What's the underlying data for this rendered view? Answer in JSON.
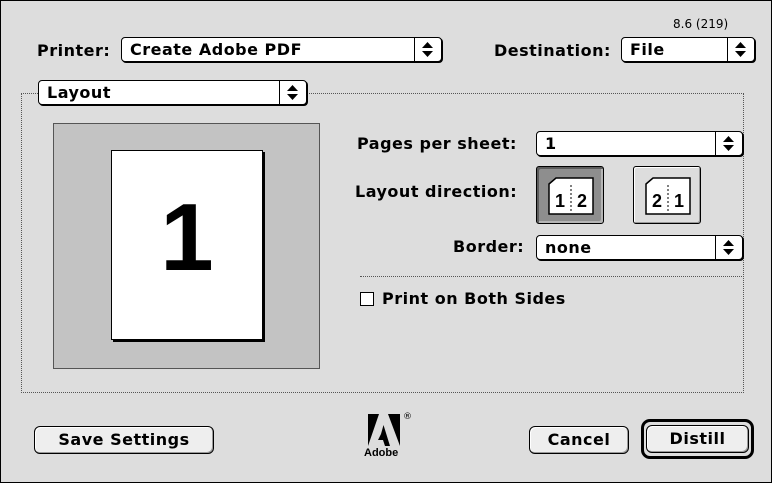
{
  "version": "8.6 (219)",
  "printer": {
    "label": "Printer:",
    "value": "Create Adobe PDF"
  },
  "destination": {
    "label": "Destination:",
    "value": "File"
  },
  "panel": {
    "value": "Layout"
  },
  "preview": {
    "page_number": "1"
  },
  "pages_per_sheet": {
    "label": "Pages per sheet:",
    "value": "1"
  },
  "layout_direction": {
    "label": "Layout direction:",
    "options": [
      {
        "id": "left-to-right",
        "digits": [
          "1",
          "2"
        ],
        "selected": true
      },
      {
        "id": "right-to-left",
        "digits": [
          "2",
          "1"
        ],
        "selected": false
      }
    ]
  },
  "border": {
    "label": "Border:",
    "value": "none"
  },
  "print_both_sides": {
    "label": "Print on Both Sides",
    "checked": false
  },
  "buttons": {
    "save": "Save Settings",
    "cancel": "Cancel",
    "distill": "Distill"
  },
  "logo": {
    "text": "Adobe",
    "reg": "®"
  },
  "colors": {
    "dialog_bg": "#dddddd",
    "preview_bg": "#c3c3c3",
    "selected_button": "#8e8e8e"
  }
}
